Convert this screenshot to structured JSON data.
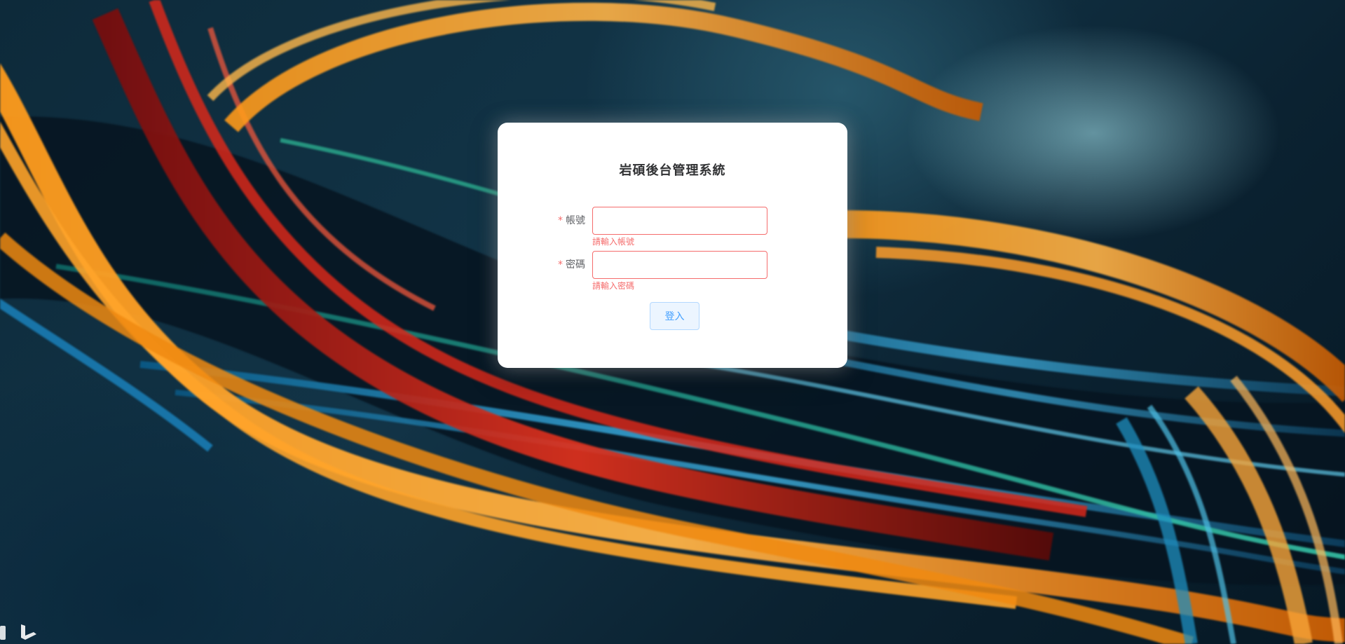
{
  "login": {
    "title": "岩碩後台管理系統",
    "required_mark": "*",
    "account_label": "帳號",
    "account_value": "",
    "account_error": "請輸入帳號",
    "password_label": "密碼",
    "password_value": "",
    "password_error": "請輸入密碼",
    "submit_label": "登入"
  },
  "colors": {
    "error": "#f56c6c",
    "button_bg": "#ecf5ff",
    "button_border": "#b3d8ff",
    "button_text": "#409eff",
    "card_bg": "#ffffff"
  },
  "background": {
    "description_icon": "bing-logo-icon"
  }
}
